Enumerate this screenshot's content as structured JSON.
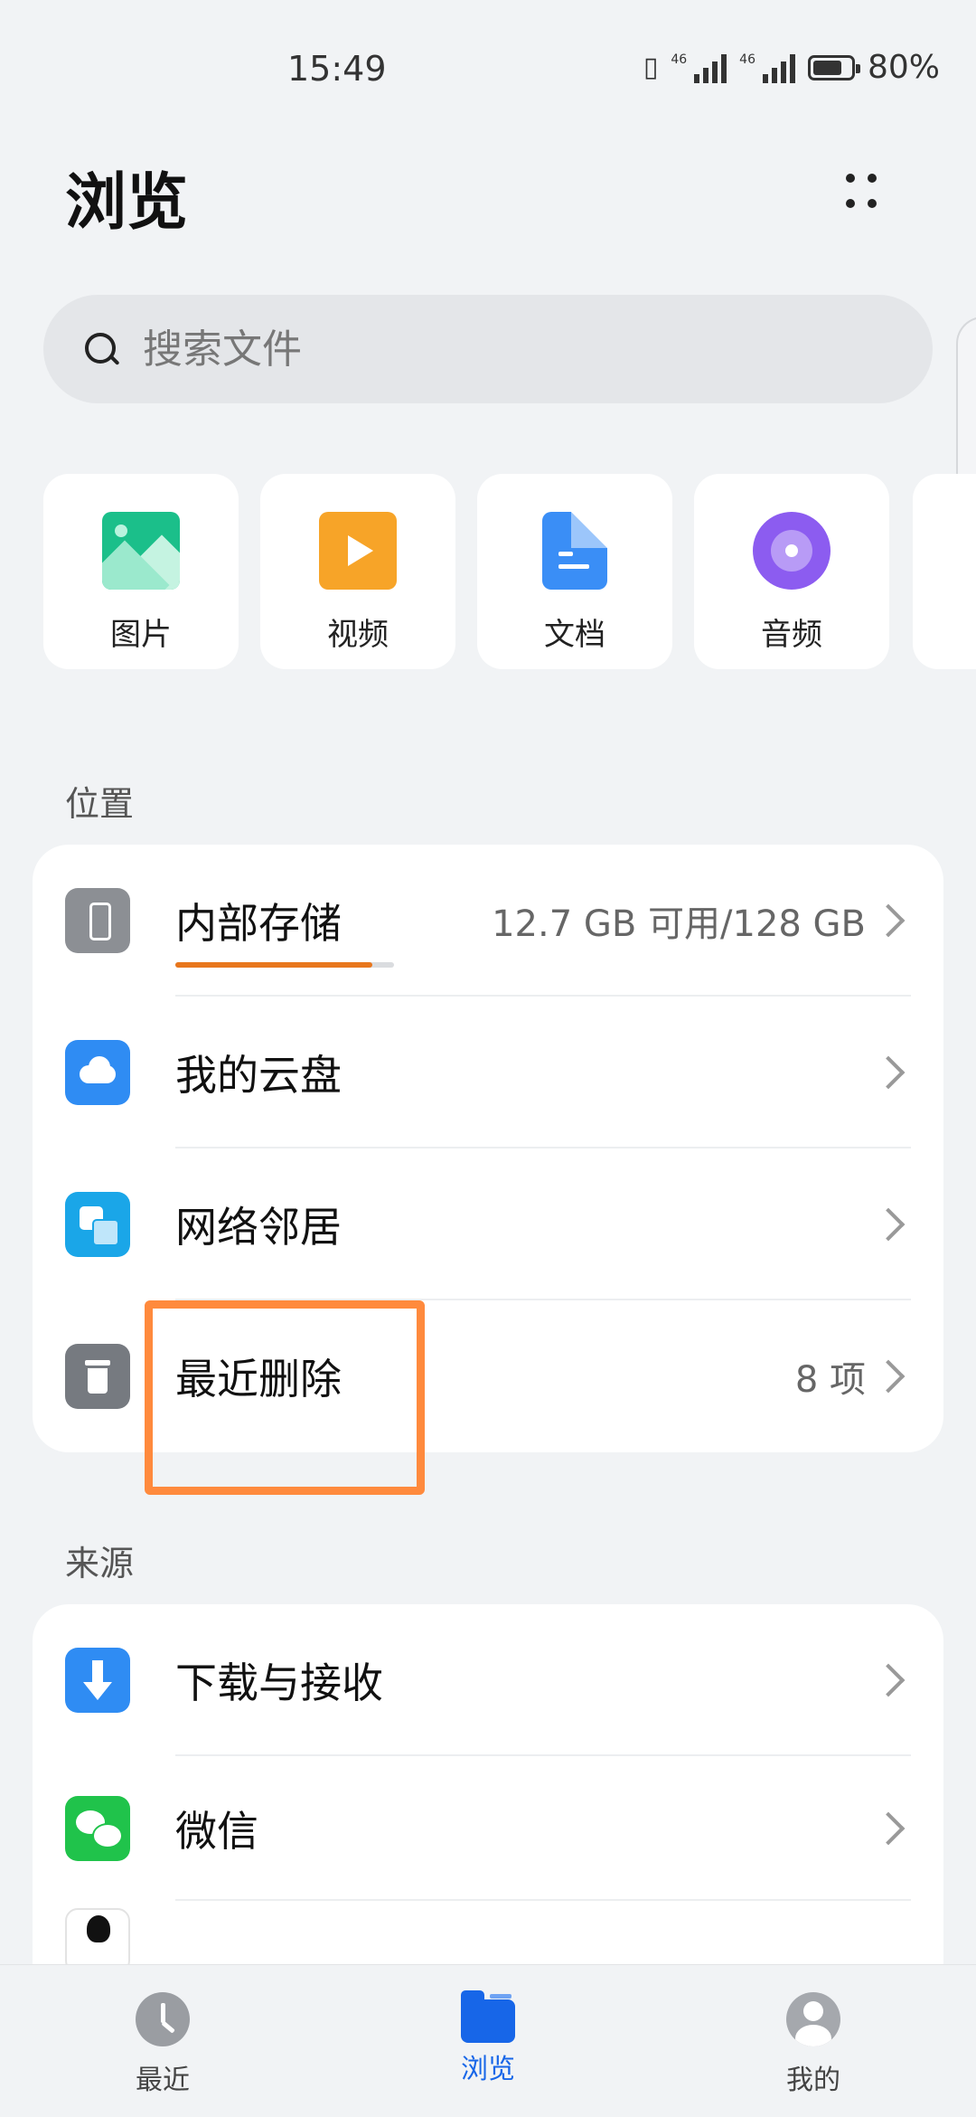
{
  "status_bar": {
    "time": "15:49",
    "signal1": "46",
    "signal2": "46",
    "battery": "80%",
    "battery_level": 0.8
  },
  "header": {
    "title": "浏览"
  },
  "search": {
    "placeholder": "搜索文件"
  },
  "categories": [
    {
      "label": "图片",
      "icon": "image-icon"
    },
    {
      "label": "视频",
      "icon": "video-icon"
    },
    {
      "label": "文档",
      "icon": "document-icon"
    },
    {
      "label": "音频",
      "icon": "audio-icon"
    }
  ],
  "locations": {
    "title": "位置",
    "items": [
      {
        "label": "内部存储",
        "value": "12.7 GB 可用/128 GB",
        "icon": "phone-icon",
        "storage_used_fraction": 0.9
      },
      {
        "label": "我的云盘",
        "value": "",
        "icon": "cloud-icon"
      },
      {
        "label": "网络邻居",
        "value": "",
        "icon": "network-icon"
      },
      {
        "label": "最近删除",
        "value": "8 项",
        "icon": "trash-icon"
      }
    ]
  },
  "sources": {
    "title": "来源",
    "items": [
      {
        "label": "下载与接收",
        "icon": "download-icon"
      },
      {
        "label": "微信",
        "icon": "wechat-icon"
      }
    ]
  },
  "bottom_nav": {
    "items": [
      {
        "label": "最近",
        "icon": "clock-icon",
        "active": false
      },
      {
        "label": "浏览",
        "icon": "folder-icon",
        "active": true
      },
      {
        "label": "我的",
        "icon": "user-icon",
        "active": false
      }
    ]
  },
  "colors": {
    "accent": "#1766e8",
    "storage_bar": "#e8761c",
    "highlight": "#ff8a3d"
  }
}
